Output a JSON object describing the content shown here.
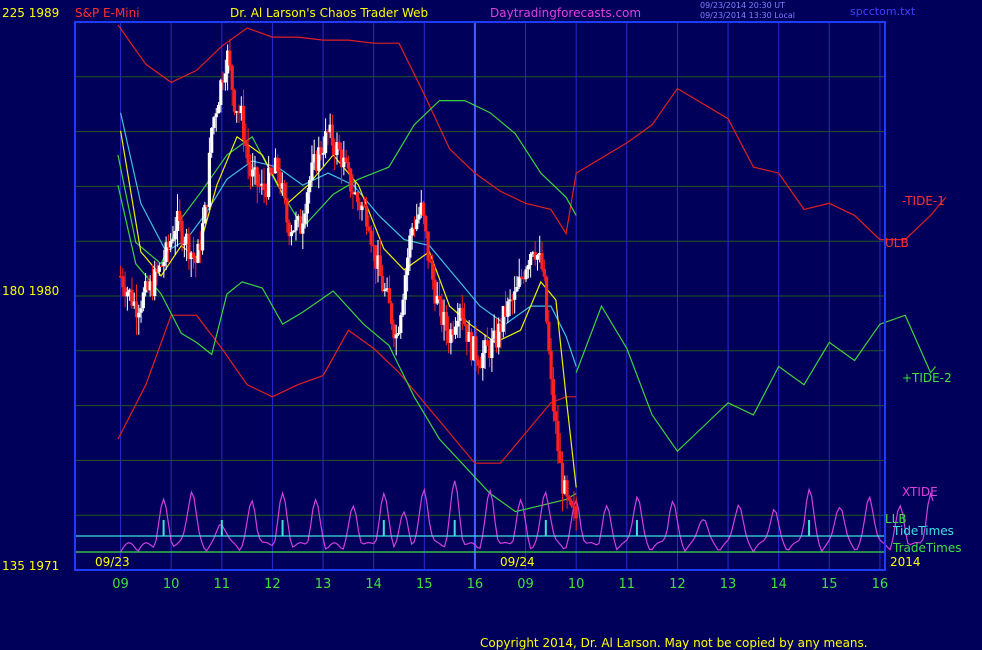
{
  "header": {
    "instrument": "S&P E-Mini",
    "title": "Dr. Al Larson's Chaos Trader Web",
    "site": "Daytradingforecasts.com",
    "time_ut": "09/23/2014 20:30 UT",
    "time_local": "09/23/2014 13:30 Local",
    "file": "spcctom.txt"
  },
  "footer": {
    "copyright": "Copyright 2014, Dr. Al Larson. May not be copied by any means."
  },
  "colors": {
    "background": "#00005a",
    "frame": "#1e3cff",
    "grid_h": "#1f5a1f",
    "grid_v": "#2a2ad0",
    "upper_band": "#e02020",
    "lower_band": "#e02020",
    "green_band": "#40d040",
    "ma_yellow": "#f0f000",
    "ma_cyan": "#40c0e0",
    "xtide": "#d040e0",
    "tide_times": "#40e0e0",
    "trade_times": "#40e040",
    "bar_up": "#ffffff",
    "bar_down": "#ff2020",
    "axis_text": "#ffff00",
    "x_axis_text": "#40e040"
  },
  "chart_data": {
    "type": "candlestick",
    "y_axis_left": [
      {
        "value": 1989,
        "left_label": "225",
        "right_label": "1989"
      },
      {
        "value": 1980,
        "left_label": "180",
        "right_label": "1980"
      },
      {
        "value": 1971,
        "left_label": "135",
        "right_label": "1971"
      }
    ],
    "ylim": [
      1971,
      1989
    ],
    "x_hours": [
      "09",
      "10",
      "11",
      "12",
      "13",
      "14",
      "15",
      "16",
      "09",
      "10",
      "11",
      "12",
      "13",
      "14",
      "15",
      "16"
    ],
    "date_labels": [
      "09/23",
      "09/24"
    ],
    "year_label": "2014",
    "series_labels": {
      "tide1": "-TIDE-1",
      "ulb": "ULB",
      "tide2": "+TIDE-2",
      "xtide": "XTIDE",
      "llb": "LLB",
      "tide_times": "TideTimes",
      "trade_times": "TradeTimes"
    },
    "price_path": [
      [
        0,
        1980.6
      ],
      [
        0.3,
        1979.6
      ],
      [
        0.6,
        1980.2
      ],
      [
        0.9,
        1981.3
      ],
      [
        1.1,
        1982.4
      ],
      [
        1.3,
        1981.8
      ],
      [
        1.5,
        1981.0
      ],
      [
        1.7,
        1983.0
      ],
      [
        1.8,
        1985.5
      ],
      [
        1.95,
        1986.7
      ],
      [
        2.1,
        1988.0
      ],
      [
        2.25,
        1986.4
      ],
      [
        2.4,
        1985.8
      ],
      [
        2.55,
        1984.0
      ],
      [
        2.8,
        1983.4
      ],
      [
        3.1,
        1984.2
      ],
      [
        3.3,
        1982.3
      ],
      [
        3.55,
        1982.2
      ],
      [
        3.7,
        1983.6
      ],
      [
        3.9,
        1984.6
      ],
      [
        4.1,
        1985.3
      ],
      [
        4.35,
        1984.6
      ],
      [
        4.5,
        1983.8
      ],
      [
        4.7,
        1983.0
      ],
      [
        4.9,
        1982.6
      ],
      [
        5.0,
        1981.4
      ],
      [
        5.15,
        1980.4
      ],
      [
        5.3,
        1979.6
      ],
      [
        5.45,
        1978.6
      ],
      [
        5.6,
        1980.4
      ],
      [
        5.75,
        1982.2
      ],
      [
        5.95,
        1982.8
      ],
      [
        6.1,
        1981.0
      ],
      [
        6.3,
        1979.4
      ],
      [
        6.5,
        1978.6
      ],
      [
        6.7,
        1979.8
      ],
      [
        6.9,
        1978.3
      ],
      [
        7.1,
        1977.9
      ],
      [
        7.4,
        1978.4
      ],
      [
        7.6,
        1979.4
      ],
      [
        7.8,
        1979.9
      ],
      [
        8.0,
        1981.0
      ],
      [
        8.15,
        1981.7
      ],
      [
        8.35,
        1980.7
      ],
      [
        8.5,
        1977.0
      ],
      [
        8.7,
        1974.0
      ],
      [
        8.85,
        1972.8
      ],
      [
        9.0,
        1972.6
      ]
    ],
    "upper_band": [
      [
        -0.05,
        1988.9
      ],
      [
        0.5,
        1987.6
      ],
      [
        1.0,
        1987.0
      ],
      [
        1.5,
        1987.4
      ],
      [
        2.0,
        1988.2
      ],
      [
        2.5,
        1988.8
      ],
      [
        3.0,
        1988.5
      ],
      [
        3.5,
        1988.5
      ],
      [
        4.0,
        1988.4
      ],
      [
        4.5,
        1988.4
      ],
      [
        5.0,
        1988.3
      ],
      [
        5.5,
        1988.3
      ],
      [
        6.0,
        1986.6
      ],
      [
        6.5,
        1984.8
      ],
      [
        7.0,
        1984.0
      ],
      [
        7.5,
        1983.4
      ],
      [
        8.0,
        1983.0
      ],
      [
        8.5,
        1982.8
      ],
      [
        8.8,
        1982.0
      ],
      [
        9.0,
        1984.0
      ],
      [
        9.5,
        1984.5
      ],
      [
        10.0,
        1985.0
      ],
      [
        10.5,
        1985.6
      ],
      [
        11.0,
        1986.8
      ],
      [
        11.5,
        1986.3
      ],
      [
        12.0,
        1985.8
      ],
      [
        12.5,
        1984.2
      ],
      [
        13.0,
        1984.0
      ],
      [
        13.5,
        1982.8
      ],
      [
        14.0,
        1983.0
      ],
      [
        14.5,
        1982.6
      ],
      [
        15.0,
        1981.8
      ],
      [
        15.5,
        1981.8
      ],
      [
        16.0,
        1982.6
      ],
      [
        16.3,
        1983.2
      ]
    ],
    "lower_band": [
      [
        -0.05,
        1975.2
      ],
      [
        0.5,
        1977.0
      ],
      [
        1.0,
        1979.3
      ],
      [
        1.5,
        1979.3
      ],
      [
        2.0,
        1978.2
      ],
      [
        2.5,
        1977.0
      ],
      [
        3.0,
        1976.6
      ],
      [
        3.5,
        1977.0
      ],
      [
        4.0,
        1977.3
      ],
      [
        4.5,
        1978.8
      ],
      [
        5.0,
        1978.2
      ],
      [
        5.5,
        1977.4
      ],
      [
        6.0,
        1976.4
      ],
      [
        6.5,
        1975.4
      ],
      [
        7.0,
        1974.4
      ],
      [
        7.5,
        1974.4
      ],
      [
        8.0,
        1975.4
      ],
      [
        8.5,
        1976.4
      ],
      [
        8.8,
        1976.6
      ],
      [
        9.0,
        1976.6
      ]
    ],
    "green_band_upper": [
      [
        -0.05,
        1984.6
      ],
      [
        0.3,
        1981.7
      ],
      [
        0.8,
        1981.0
      ],
      [
        1.2,
        1982.5
      ],
      [
        1.6,
        1983.4
      ],
      [
        2.1,
        1984.6
      ],
      [
        2.6,
        1985.2
      ],
      [
        3.1,
        1983.6
      ],
      [
        3.6,
        1982.2
      ],
      [
        4.2,
        1983.3
      ],
      [
        4.7,
        1983.8
      ],
      [
        5.3,
        1984.2
      ],
      [
        5.8,
        1985.6
      ],
      [
        6.3,
        1986.4
      ],
      [
        6.8,
        1986.4
      ],
      [
        7.3,
        1986.0
      ],
      [
        7.8,
        1985.3
      ],
      [
        8.3,
        1984.0
      ],
      [
        8.8,
        1983.2
      ],
      [
        9.0,
        1982.6
      ]
    ],
    "green_band_lower": [
      [
        -0.05,
        1983.6
      ],
      [
        0.3,
        1981.0
      ],
      [
        0.8,
        1980.0
      ],
      [
        1.2,
        1978.7
      ],
      [
        1.5,
        1978.4
      ],
      [
        1.8,
        1978.0
      ],
      [
        2.1,
        1980.0
      ],
      [
        2.4,
        1980.4
      ],
      [
        2.8,
        1980.2
      ],
      [
        3.2,
        1979.0
      ],
      [
        3.6,
        1979.4
      ],
      [
        4.2,
        1980.1
      ],
      [
        4.8,
        1979.0
      ],
      [
        5.3,
        1978.3
      ],
      [
        5.8,
        1976.6
      ],
      [
        6.3,
        1975.2
      ],
      [
        6.8,
        1974.3
      ],
      [
        7.3,
        1973.4
      ],
      [
        7.8,
        1972.8
      ],
      [
        8.3,
        1973.0
      ],
      [
        8.8,
        1973.2
      ],
      [
        9.0,
        1973.4
      ]
    ],
    "ma_yellow": [
      [
        0,
        1985.4
      ],
      [
        0.4,
        1981.4
      ],
      [
        0.8,
        1980.6
      ],
      [
        1.2,
        1981.6
      ],
      [
        1.5,
        1981.2
      ],
      [
        1.9,
        1983.6
      ],
      [
        2.3,
        1985.2
      ],
      [
        2.8,
        1984.6
      ],
      [
        3.3,
        1983.0
      ],
      [
        3.7,
        1983.6
      ],
      [
        4.2,
        1984.6
      ],
      [
        4.7,
        1983.6
      ],
      [
        5.2,
        1981.5
      ],
      [
        5.6,
        1980.8
      ],
      [
        6.1,
        1981.4
      ],
      [
        6.5,
        1979.6
      ],
      [
        6.9,
        1979.0
      ],
      [
        7.4,
        1978.4
      ],
      [
        7.9,
        1978.8
      ],
      [
        8.3,
        1980.4
      ],
      [
        8.6,
        1979.8
      ],
      [
        8.8,
        1976.6
      ],
      [
        9.0,
        1973.6
      ]
    ],
    "ma_cyan": [
      [
        0,
        1986.0
      ],
      [
        0.4,
        1983.0
      ],
      [
        0.9,
        1981.4
      ],
      [
        1.3,
        1981.8
      ],
      [
        1.7,
        1982.7
      ],
      [
        2.1,
        1983.8
      ],
      [
        2.6,
        1984.4
      ],
      [
        3.1,
        1984.2
      ],
      [
        3.6,
        1983.6
      ],
      [
        4.1,
        1984.0
      ],
      [
        4.6,
        1983.6
      ],
      [
        5.1,
        1982.6
      ],
      [
        5.6,
        1981.8
      ],
      [
        6.1,
        1981.6
      ],
      [
        6.6,
        1980.6
      ],
      [
        7.1,
        1979.6
      ],
      [
        7.6,
        1979.0
      ],
      [
        8.1,
        1979.6
      ],
      [
        8.5,
        1979.6
      ],
      [
        8.8,
        1978.6
      ],
      [
        9.0,
        1977.6
      ]
    ],
    "xtide_peaks": [
      [
        0.85,
        0.7
      ],
      [
        1.4,
        0.9
      ],
      [
        2.0,
        0.4
      ],
      [
        2.6,
        0.7
      ],
      [
        3.2,
        0.8
      ],
      [
        3.85,
        0.7
      ],
      [
        4.6,
        0.6
      ],
      [
        5.2,
        0.8
      ],
      [
        5.6,
        0.5
      ],
      [
        6.0,
        0.9
      ],
      [
        6.6,
        1.0
      ],
      [
        7.3,
        0.85
      ],
      [
        7.9,
        0.7
      ],
      [
        8.4,
        0.9
      ],
      [
        9.0,
        0.7
      ],
      [
        9.6,
        0.6
      ],
      [
        10.2,
        0.8
      ],
      [
        10.9,
        0.7
      ],
      [
        11.5,
        0.5
      ],
      [
        12.2,
        0.7
      ],
      [
        12.9,
        0.6
      ],
      [
        13.6,
        0.9
      ],
      [
        14.2,
        0.7
      ],
      [
        14.8,
        0.8
      ],
      [
        15.4,
        0.6
      ],
      [
        16.0,
        0.8
      ]
    ]
  }
}
